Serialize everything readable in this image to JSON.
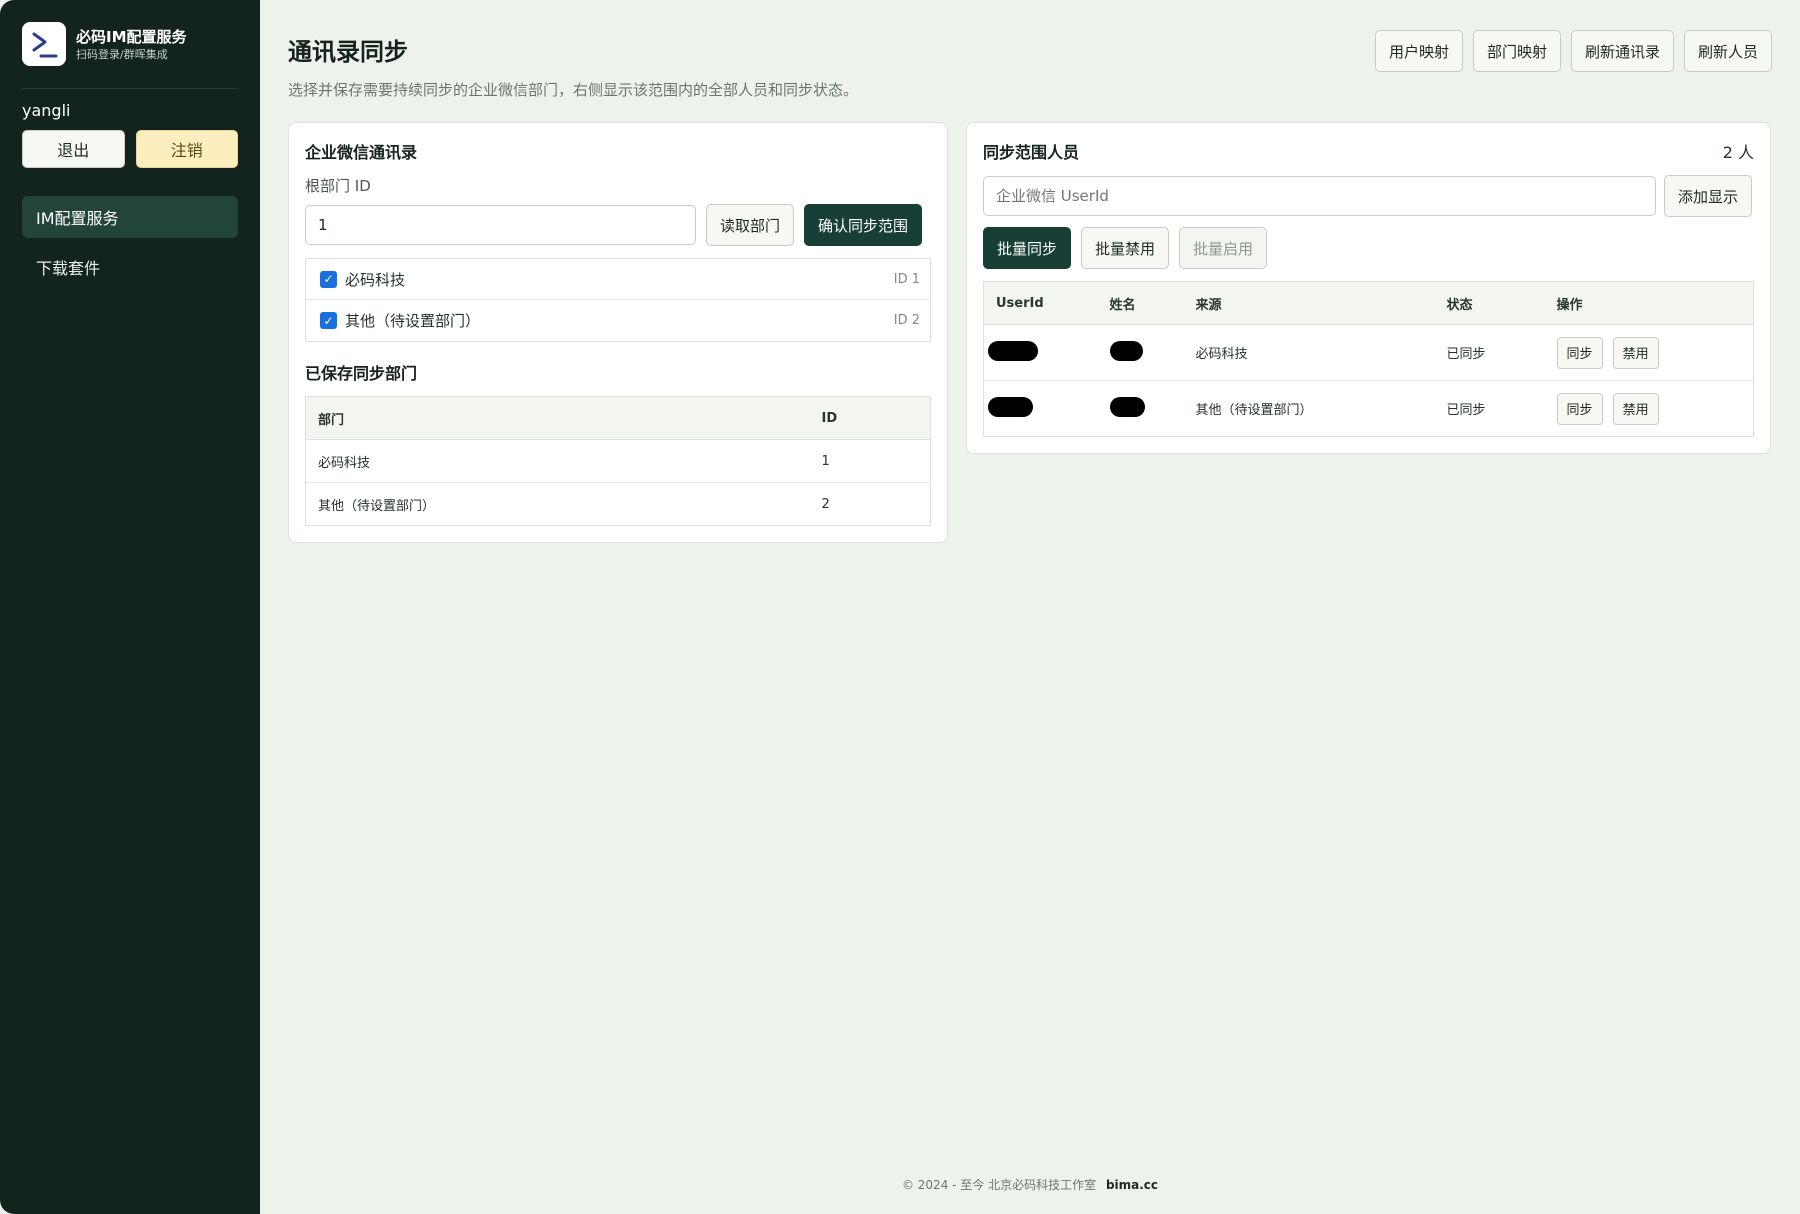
{
  "brand": {
    "title": "必码IM配置服务",
    "subtitle": "扫码登录/群晖集成",
    "logo_icon": "terminal-prompt-icon"
  },
  "user": {
    "name": "yangli",
    "logout_label": "退出",
    "deregister_label": "注销"
  },
  "nav": {
    "items": [
      {
        "label": "IM配置服务",
        "active": true
      },
      {
        "label": "下载套件",
        "active": false
      }
    ]
  },
  "header": {
    "title": "通讯录同步",
    "description": "选择并保存需要持续同步的企业微信部门，右侧显示该范围内的全部人员和同步状态。",
    "actions": {
      "user_mapping": "用户映射",
      "dept_mapping": "部门映射",
      "refresh_contacts": "刷新通讯录",
      "refresh_people": "刷新人员"
    }
  },
  "contacts_panel": {
    "title": "企业微信通讯录",
    "root_label": "根部门 ID",
    "root_value": "1",
    "read_button": "读取部门",
    "confirm_button": "确认同步范围",
    "departments": [
      {
        "name": "必码科技",
        "id_label": "ID 1",
        "checked": true
      },
      {
        "name": "其他（待设置部门）",
        "id_label": "ID 2",
        "checked": true
      }
    ],
    "saved_title": "已保存同步部门",
    "saved_table": {
      "headers": [
        "部门",
        "ID"
      ],
      "rows": [
        {
          "dept": "必码科技",
          "id": "1"
        },
        {
          "dept": "其他（待设置部门）",
          "id": "2"
        }
      ]
    }
  },
  "people_panel": {
    "title": "同步范围人员",
    "count": "2 人",
    "userid_placeholder": "企业微信 UserId",
    "add_button": "添加显示",
    "batch_sync": "批量同步",
    "batch_disable": "批量禁用",
    "batch_enable": "批量启用",
    "table": {
      "headers": [
        "UserId",
        "姓名",
        "来源",
        "状态",
        "操作"
      ],
      "rows": [
        {
          "source": "必码科技",
          "status": "已同步",
          "sync": "同步",
          "disable": "禁用"
        },
        {
          "source": "其他（待设置部门）",
          "status": "已同步",
          "sync": "同步",
          "disable": "禁用"
        }
      ]
    }
  },
  "footer": {
    "text": "© 2024 - 至今 北京必码科技工作室",
    "link": "bima.cc"
  },
  "colors": {
    "sidebar_bg": "#13231e",
    "primary": "#183f35",
    "active_nav": "#23443a",
    "warn_button": "#fdeec0",
    "checkbox": "#1a6fe0"
  }
}
